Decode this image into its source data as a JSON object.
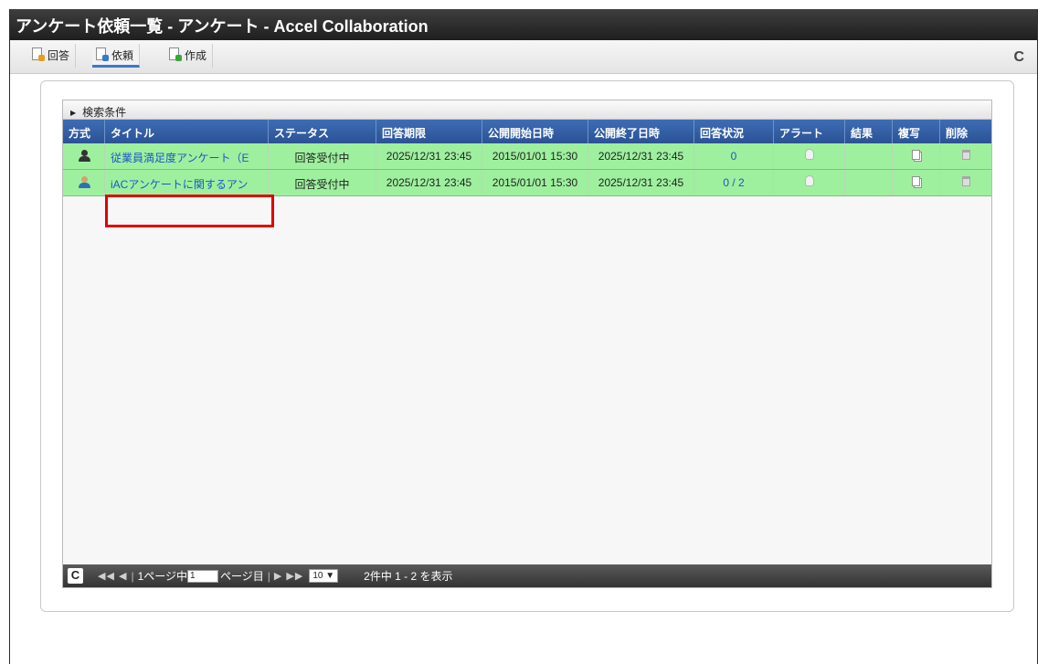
{
  "window": {
    "title": "アンケート依頼一覧 - アンケート - Accel Collaboration"
  },
  "toolbar": {
    "tabs": [
      {
        "label": "回答",
        "icon": "answer-doc-icon",
        "badge_color": "#e0a020"
      },
      {
        "label": "依頼",
        "icon": "request-doc-icon",
        "badge_color": "#3c78c9"
      },
      {
        "label": "作成",
        "icon": "create-doc-icon",
        "badge_color": "#3aa63a"
      }
    ],
    "active_tab": "依頼",
    "reload_glyph": "C"
  },
  "search": {
    "label": "検索条件",
    "toggle_glyph": "▶"
  },
  "table": {
    "columns": [
      "方式",
      "タイトル",
      "ステータス",
      "回答期限",
      "公開開始日時",
      "公開終了日時",
      "回答状況",
      "アラート",
      "結果",
      "複写",
      "削除"
    ],
    "rows": [
      {
        "method_icon": "anonymous-person-icon",
        "title": "従業員満足度アンケート（E",
        "status": "回答受付中",
        "deadline": "2025/12/31 23:45",
        "publish_start": "2015/01/01 15:30",
        "publish_end": "2025/12/31 23:45",
        "answer_status": "0",
        "alert_icon": "bulb-icon",
        "result": "",
        "copy_icon": "copy-icon",
        "delete_icon": "trash-icon"
      },
      {
        "method_icon": "named-person-icon",
        "title": "iACアンケートに関するアン",
        "status": "回答受付中",
        "deadline": "2025/12/31 23:45",
        "publish_start": "2015/01/01 15:30",
        "publish_end": "2025/12/31 23:45",
        "answer_status": "0 / 2",
        "alert_icon": "bulb-icon",
        "result": "",
        "copy_icon": "copy-icon",
        "delete_icon": "trash-icon"
      }
    ]
  },
  "pager": {
    "refresh_glyph": "C",
    "first_prev": "◀◀ ◀",
    "page_prefix": "1ページ中",
    "page_value": "1",
    "page_suffix": "ページ目",
    "next_last": "▶ ▶▶",
    "rows_per_page": "10 ▼",
    "summary": "2件中 1 - 2 を表示"
  },
  "colors": {
    "row_bg": "#9ef09e",
    "header_bg": "#2f5ba2",
    "highlight": "#e00000",
    "link": "#1a57c9"
  }
}
